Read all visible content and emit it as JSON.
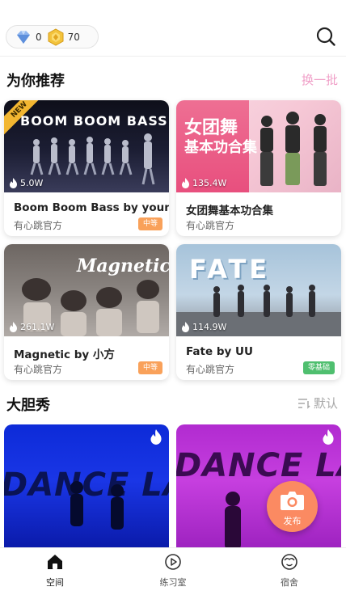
{
  "header": {
    "diamond_count": "0",
    "coin_count": "70"
  },
  "recommend": {
    "title": "为你推荐",
    "action": "换一批",
    "cards": [
      {
        "thumb_text": "BOOM BOOM BASS",
        "badge": "NEW",
        "views": "5.0W",
        "title": "Boom Boom Bass by young",
        "author": "有心跳官方",
        "level": "中等",
        "level_color": "#f9a15a"
      },
      {
        "thumb_text": "女团舞",
        "thumb_text2": "基本功合集",
        "views": "135.4W",
        "title": "女团舞基本功合集",
        "author": "有心跳官方",
        "level": "",
        "level_color": ""
      },
      {
        "thumb_text": "Magnetic",
        "views": "261.1W",
        "title": "Magnetic by 小方",
        "author": "有心跳官方",
        "level": "中等",
        "level_color": "#f9a15a"
      },
      {
        "thumb_text": "FATE",
        "views": "114.9W",
        "title": "Fate by UU",
        "author": "有心跳官方",
        "level": "零基础",
        "level_color": "#4fbf6f"
      }
    ]
  },
  "show": {
    "title": "大胆秀",
    "sort_label": "默认"
  },
  "fab": {
    "label": "发布"
  },
  "nav": [
    {
      "label": "空间"
    },
    {
      "label": "练习室"
    },
    {
      "label": "宿舍"
    }
  ],
  "colors": {
    "accent_pink": "#f0a0c8",
    "fab": "#fb8a62",
    "tag_medium": "#f9a15a",
    "tag_beginner": "#4fbf6f"
  }
}
